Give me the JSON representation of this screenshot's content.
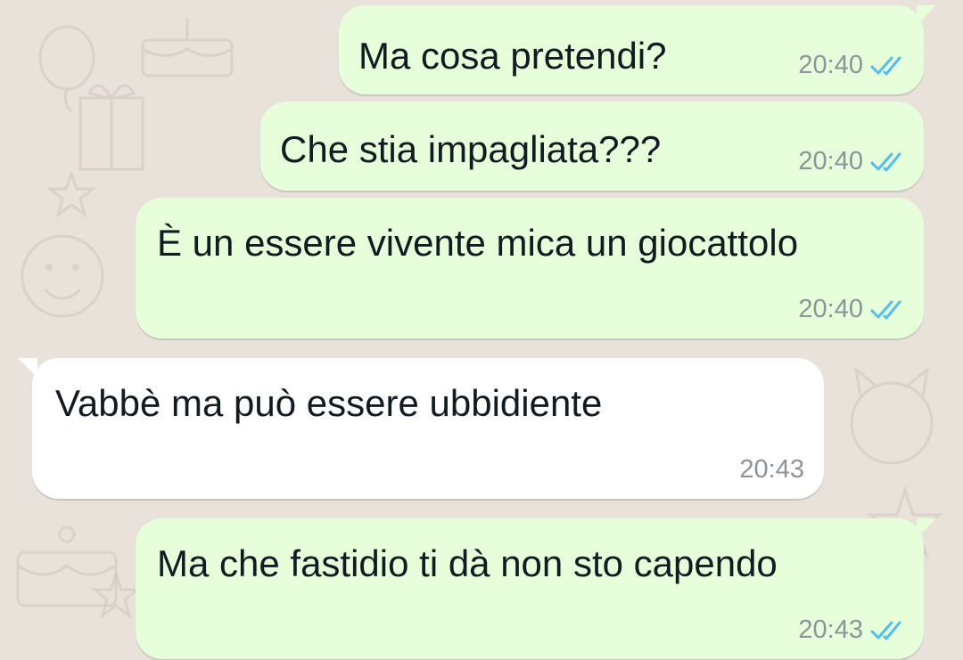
{
  "chat": {
    "messages": [
      {
        "direction": "outgoing",
        "text": "Ma cosa pretendi?",
        "time": "20:40",
        "status": "read"
      },
      {
        "direction": "outgoing",
        "text": "Che stia impagliata???",
        "time": "20:40",
        "status": "read"
      },
      {
        "direction": "outgoing",
        "text": "È un essere vivente mica un giocattolo",
        "time": "20:40",
        "status": "read"
      },
      {
        "direction": "incoming",
        "text": "Vabbè ma può essere ubbidiente",
        "time": "20:43"
      },
      {
        "direction": "outgoing",
        "text": "Ma che fastidio ti dà non sto capendo",
        "time": "20:43",
        "status": "read"
      }
    ]
  },
  "colors": {
    "background": "#e9e2da",
    "outgoing_bubble": "#e6ffda",
    "incoming_bubble": "#ffffff",
    "read_ticks": "#53bdeb",
    "timestamp": "#8c9499"
  },
  "icons": {
    "read_status": "double-check-icon",
    "wallpaper": "doodle-pattern"
  }
}
